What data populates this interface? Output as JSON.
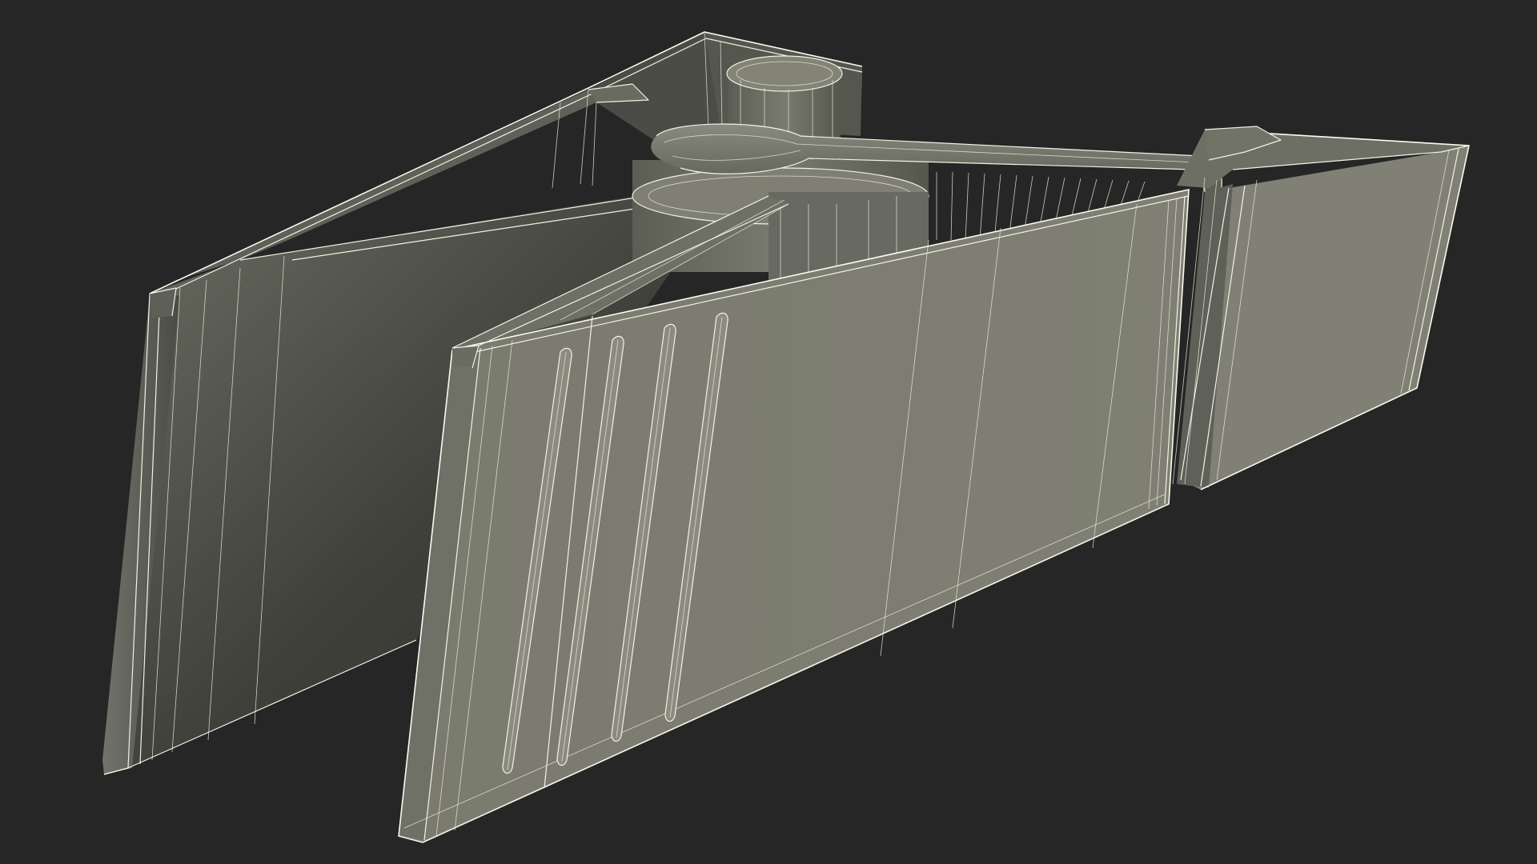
{
  "scene": {
    "subject": "clothespin-wireframe-render",
    "colors": {
      "background": "#262626",
      "face_light": "#7d7e71",
      "face_mid": "#6c6d62",
      "face_dark": "#3d3e37",
      "face_shadow": "#2f302b",
      "wire": "#f2f2e6"
    }
  }
}
